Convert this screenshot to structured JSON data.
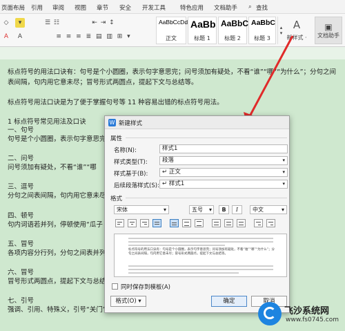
{
  "menu": [
    "页面布局",
    "引用",
    "审阅",
    "视图",
    "章节",
    "安全",
    "开发工具",
    "特色应用",
    "文档助手",
    "查找"
  ],
  "styles": [
    {
      "sample": "AaBbCcDd",
      "label": "正文"
    },
    {
      "sample": "AaBb",
      "label": "标题 1"
    },
    {
      "sample": "AaBbC",
      "label": "标题 2"
    },
    {
      "sample": "AaBbC",
      "label": "标题 3"
    }
  ],
  "toolbar": {
    "new_style": "新样式 ·",
    "doc_assistant": "文档助手"
  },
  "doc": {
    "lines": [
      "标点符号的用法口诀有：句号是个小圆圈，表示句字意思完；问号须加有疑处，不看“谁”“哪”“为什么”；分句之间",
      "表间隔，句内用它意未尽；冒号形式两圆点，提起下文与总结等。",
      "",
      "标点符号用法口诀是为了便于掌握句号等 11 种容易出错的标点符号用法。",
      "",
      "1 标点符号常见用法及口诀",
      "一、句号",
      "句号是个小圆圈，表示句字意思完",
      "",
      "二、问号",
      "问号须加有疑处，不看“谁”“哪",
      "",
      "三、逗号",
      "分句之间表间隔，句内用它意未尽",
      "",
      "四、顿号",
      "句内词语若并列，停顿使用“瓜子",
      "",
      "五、冒号",
      "各项内容分行列，分句之间表并列",
      "",
      "六、冒号",
      "冒号形式两圆点，提起下文与总结",
      "",
      "七、引号",
      "强调、引用、特殊义，引号“关门”作标志，引文末尾标点分 独立 全引使用放里面，"
    ]
  },
  "dialog": {
    "title": "新建样式",
    "section_props": "属性",
    "name_label": "名称(N):",
    "name_value": "样式1",
    "type_label": "样式类型(T):",
    "type_value": "段落",
    "based_label": "样式基于(B):",
    "based_value": "↵ 正文",
    "next_label": "后续段落样式(S):",
    "next_value": "↵ 样式1",
    "section_format": "格式",
    "font_value": "宋体",
    "size_value": "五号",
    "bold": "B",
    "italic": "I",
    "lang_value": "中文",
    "preview_text": "标点符号的用法口诀有：句号是个小圆圈，表示句字意思完；问号须加有疑处，不看“谁”“哪”“为什么”；分句之间表间隔，句内用它意未尽；冒号形式两圆点，提起下文与总结等。",
    "sync_label": "同时保存到模板(A)",
    "format_button": "格式(O) ▾",
    "ok_button": "确定",
    "cancel_button": "取消"
  },
  "watermark": {
    "brand": "飞沙系统网",
    "url": "www.fs0745.com"
  }
}
